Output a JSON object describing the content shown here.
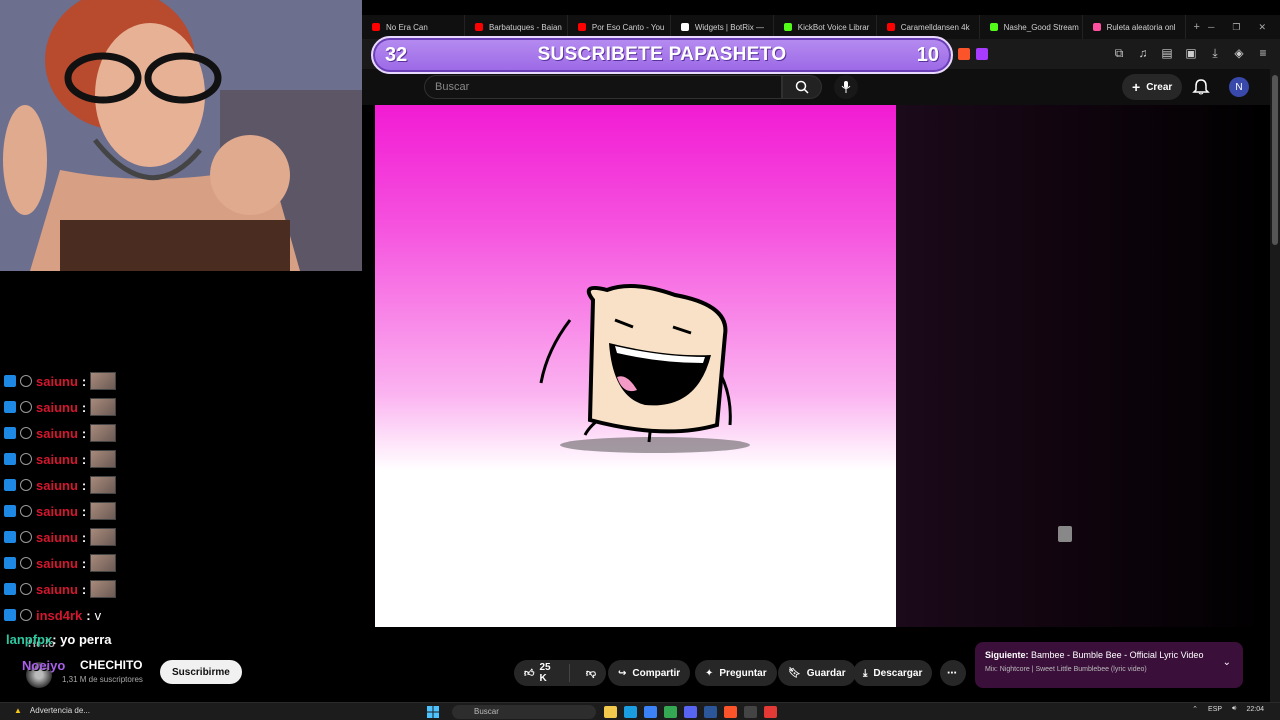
{
  "browser": {
    "tabs": [
      {
        "label": "No Era Can",
        "color": "#ff0000"
      },
      {
        "label": "Barbatuques - Baian",
        "color": "#ff0000"
      },
      {
        "label": "Por Eso Canto - You",
        "color": "#ff0000"
      },
      {
        "label": "Widgets | BotRix —",
        "color": "#ffffff"
      },
      {
        "label": "KickBot Voice Librar",
        "color": "#53fc18"
      },
      {
        "label": "Caramelldansen 4k",
        "color": "#ff0000"
      },
      {
        "label": "Nashe_Good Stream",
        "color": "#53fc18"
      },
      {
        "label": "Ruleta aleatoria onl",
        "color": "#ff4fa1"
      }
    ],
    "new_tab": "+"
  },
  "overlay_banner": {
    "left_count": "32",
    "title": "SUSCRIBETE PAPASHETO",
    "right_count": "10"
  },
  "youtube": {
    "search_placeholder": "Buscar",
    "create_label": "Crear",
    "avatar_letter": "N",
    "channel_name": "CHECHITO",
    "subscribers": "1,31 M de suscriptores",
    "subscribe_label": "Suscribirme",
    "likes": "25 K",
    "share_label": "Compartir",
    "ask_label": "Preguntar",
    "save_label": "Guardar",
    "download_label": "Descargar",
    "next_prefix": "Siguiente:",
    "next_title": "Bambee - Bumble Bee - Official Lyric Video",
    "next_mix": "Mix: Nightcore | Sweet Little Bumblebee (lyric video)"
  },
  "chat": {
    "messages": [
      {
        "user": "saiunu",
        "sep": ":",
        "emote": true
      },
      {
        "user": "saiunu",
        "sep": ":",
        "emote": true
      },
      {
        "user": "saiunu",
        "sep": ":",
        "emote": true
      },
      {
        "user": "saiunu",
        "sep": ":",
        "emote": true
      },
      {
        "user": "saiunu",
        "sep": ":",
        "emote": true
      },
      {
        "user": "saiunu",
        "sep": ":",
        "emote": true
      },
      {
        "user": "saiunu",
        "sep": ":",
        "emote": true
      },
      {
        "user": "saiunu",
        "sep": ":",
        "emote": true
      },
      {
        "user": "saiunu",
        "sep": ":",
        "emote": true
      },
      {
        "user": "insd4rk",
        "sep": ":",
        "text": "v"
      }
    ],
    "overlay_user1": "lanpfpx",
    "overlay_msg1": ": yo perra",
    "overlay_hello": "Hello",
    "overlay_user2": "Noeiyo"
  },
  "taskbar": {
    "warning": "Advertencia de...",
    "search_placeholder": "Buscar",
    "language": "ESP",
    "time": "22:04"
  }
}
